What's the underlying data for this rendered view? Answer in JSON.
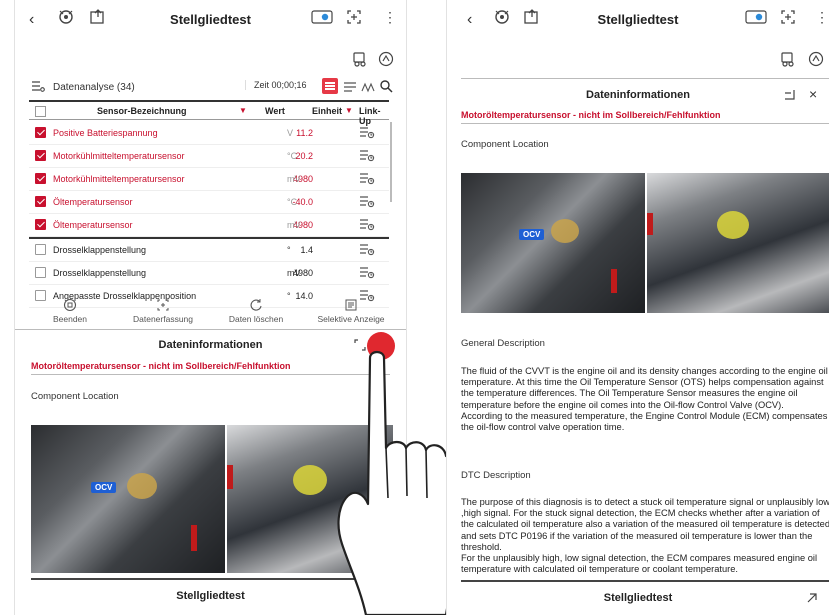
{
  "left": {
    "header": {
      "back": "‹",
      "title": "Stellgliedtest",
      "more": "⋮"
    },
    "toolbar": {
      "label": "Datenanalyse (34)",
      "time": "Zeit 00;00;16"
    },
    "table": {
      "headers": {
        "name": "Sensor-Bezeichnung",
        "value": "Wert",
        "unit": "Einheit",
        "link": "Link-Up"
      },
      "rows": [
        {
          "name": "Positive Batteriespannung",
          "value": "11.2",
          "unit": "V",
          "selected": true
        },
        {
          "name": "Motorkühlmitteltemperatursensor",
          "value": "20.2",
          "unit": "°C",
          "selected": true
        },
        {
          "name": "Motorkühlmitteltemperatursensor",
          "value": "4980",
          "unit": "mV",
          "selected": true
        },
        {
          "name": "Öltemperatursensor",
          "value": "-40.0",
          "unit": "°C",
          "selected": true
        },
        {
          "name": "Öltemperatursensor",
          "value": "4980",
          "unit": "mV",
          "selected": true
        },
        {
          "name": "Drosselklappenstellung",
          "value": "1.4",
          "unit": "°",
          "selected": false
        },
        {
          "name": "Drosselklappenstellung",
          "value": "4980",
          "unit": "mV",
          "selected": false
        },
        {
          "name": "Angepasste Drosselklappenposition",
          "value": "14.0",
          "unit": "°",
          "selected": false
        }
      ]
    },
    "bottom_actions": {
      "end": "Beenden",
      "capture": "Datenerfassung",
      "clear": "Daten löschen",
      "selective": "Selektive Anzeige"
    },
    "panel_title": "Dateninformationen",
    "warning": "Motoröltemperatursensor - nicht im Sollbereich/Fehlfunktion",
    "component_location": "Component Location",
    "ocv_label": "OCV",
    "footer_title": "Stellgliedtest"
  },
  "right": {
    "header": {
      "back": "‹",
      "title": "Stellgliedtest",
      "more": "⋮"
    },
    "panel_title": "Dateninformationen",
    "close": "×",
    "warning": "Motoröltemperatursensor - nicht im Sollbereich/Fehlfunktion",
    "component_location": "Component Location",
    "ocv_label": "OCV",
    "general_title": "General Description",
    "general_text": "The fluid of the CVVT is the engine oil and its density changes according to the engine oil temperature. At this time the Oil Temperature Sensor (OTS) helps compensation against the temperature differences. The Oil Temperature Sensor measures the engine oil temperature before the engine oil comes into the Oil-flow Control Valve (OCV).",
    "general_text_2": "According to the measured temperature, the Engine Control Module (ECM) compensates the oil-flow control valve operation time.",
    "dtc_title": "DTC Description",
    "dtc_text": "The purpose of this diagnosis is to detect a stuck oil temperature signal or unplausibly low ,high signal. For the stuck signal detection, the ECM checks whether after a variation of the calculated oil temperature also a variation of the measured oil temperature is detected and sets DTC P0196 if the variation of the measured oil temperature is lower than the threshold.",
    "dtc_text_2": "For the unplausibly high, low signal detection, the ECM compares measured engine oil temperature with calculated oil temperature or coolant temperature.",
    "footer_title": "Stellgliedtest"
  }
}
